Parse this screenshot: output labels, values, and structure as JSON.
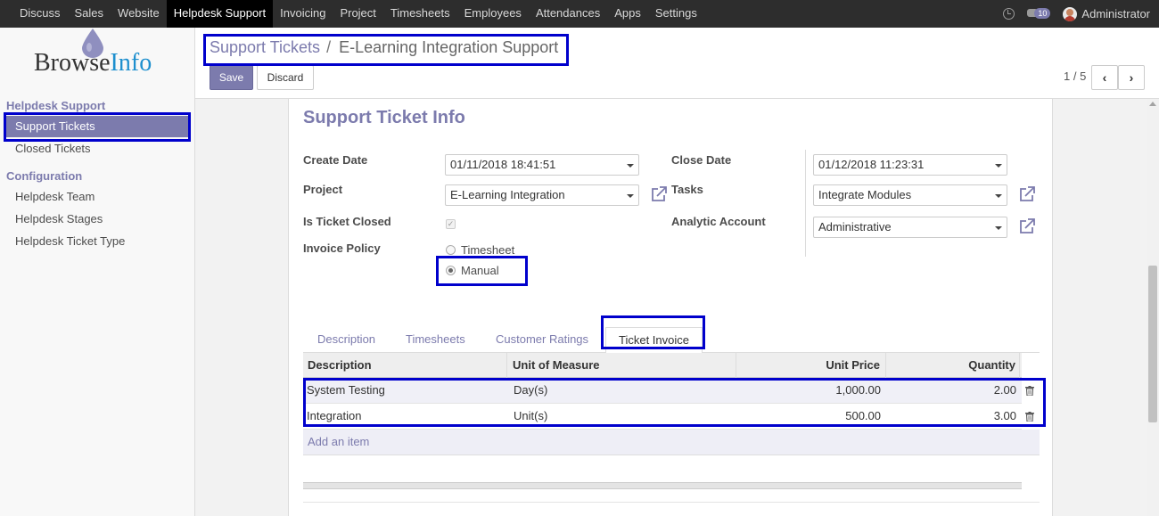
{
  "topnav": {
    "menu": [
      "Discuss",
      "Sales",
      "Website",
      "Helpdesk Support",
      "Invoicing",
      "Project",
      "Timesheets",
      "Employees",
      "Attendances",
      "Apps",
      "Settings"
    ],
    "active": "Helpdesk Support",
    "messages_count": "10",
    "user_name": "Administrator",
    "icons": [
      "clock-icon",
      "chat-icon",
      "avatar"
    ]
  },
  "logo": {
    "part1": "Browse",
    "part2": "Info"
  },
  "sidebar": {
    "section1": "Helpdesk Support",
    "items1": [
      "Support Tickets",
      "Closed Tickets"
    ],
    "section2": "Configuration",
    "items2": [
      "Helpdesk Team",
      "Helpdesk Stages",
      "Helpdesk Ticket Type"
    ],
    "active_item": "Support Tickets"
  },
  "control": {
    "breadcrumb_parent": "Support Tickets",
    "breadcrumb_sep": "/",
    "breadcrumb_current": "E-Learning Integration Support",
    "save_label": "Save",
    "discard_label": "Discard",
    "pager": "1 / 5",
    "prev_icon": "‹",
    "next_icon": "›"
  },
  "form": {
    "title": "Support Ticket Info",
    "create_date_label": "Create Date",
    "create_date": "01/11/2018 18:41:51",
    "project_label": "Project",
    "project": "E-Learning Integration",
    "closed_label": "Is Ticket Closed",
    "is_closed": true,
    "invoice_policy_label": "Invoice Policy",
    "policy_timesheet": "Timesheet",
    "policy_manual": "Manual",
    "policy_selected": "Manual",
    "close_date_label": "Close Date",
    "close_date": "01/12/2018 11:23:31",
    "tasks_label": "Tasks",
    "tasks": "Integrate Modules",
    "analytic_label": "Analytic Account",
    "analytic": "Administrative"
  },
  "tabs": [
    "Description",
    "Timesheets",
    "Customer Ratings",
    "Ticket Invoice"
  ],
  "active_tab": "Ticket Invoice",
  "invoice_table": {
    "columns": [
      "Description",
      "Unit of Measure",
      "Unit Price",
      "Quantity"
    ],
    "rows": [
      [
        "System Testing",
        "Day(s)",
        "1,000.00",
        "2.00"
      ],
      [
        "Integration",
        "Unit(s)",
        "500.00",
        "3.00"
      ]
    ],
    "add_label": "Add an item"
  },
  "colors": {
    "accent": "#7c7bad",
    "navbar": "#2d2d2d",
    "highlight": "#0000cc"
  }
}
